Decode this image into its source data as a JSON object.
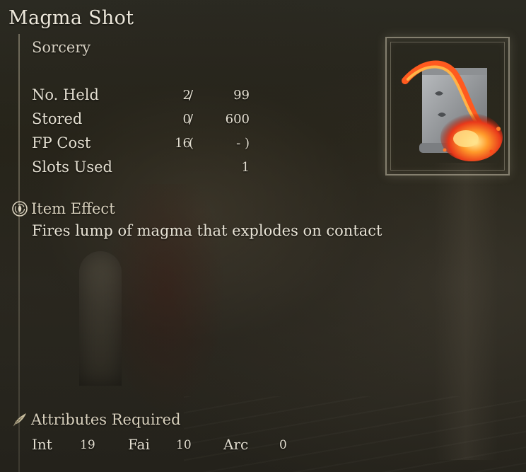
{
  "item": {
    "name": "Magma Shot",
    "type": "Sorcery"
  },
  "stats": [
    {
      "label": "No. Held",
      "a": "2",
      "sep": "/",
      "b": "99"
    },
    {
      "label": "Stored",
      "a": "0",
      "sep": "/",
      "b": "600"
    },
    {
      "label": "FP Cost",
      "a": "16",
      "sep": "(",
      "b": "- )"
    },
    {
      "label": "Slots Used",
      "a": "",
      "sep": "",
      "b": "1"
    }
  ],
  "effect": {
    "heading": "Item Effect",
    "icon": "item-effect-icon",
    "text": "Fires lump of magma that explodes on contact"
  },
  "attributes": {
    "heading": "Attributes Required",
    "icon": "feather-icon",
    "list": [
      {
        "label": "Int",
        "value": "19"
      },
      {
        "label": "Fai",
        "value": "10"
      },
      {
        "label": "Arc",
        "value": "0"
      }
    ]
  },
  "image": {
    "icon": "magma-scroll-icon"
  },
  "colors": {
    "text": "#e9e4d6",
    "heading": "#d9d1bd",
    "frame": "#cec6b0",
    "fire": "#ff5a1f"
  }
}
